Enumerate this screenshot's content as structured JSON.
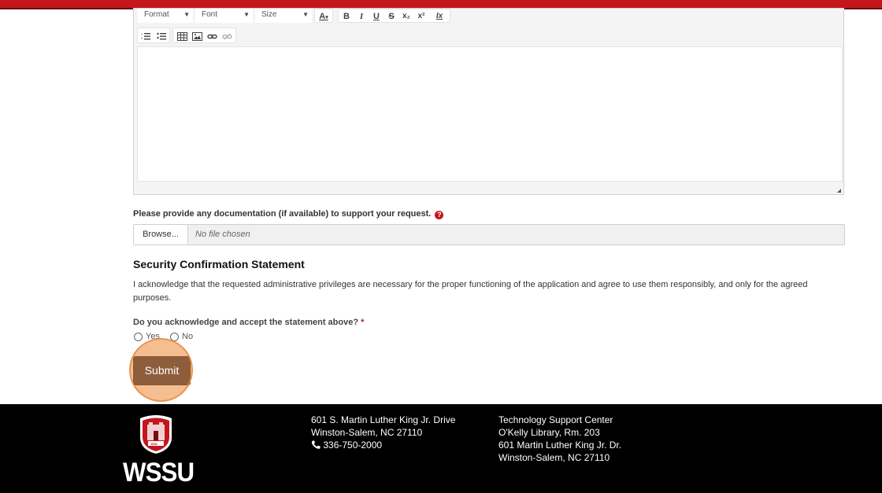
{
  "colors": {
    "brand_red": "#c4161c",
    "submit_bg": "#1b2b44",
    "highlight": "#ed8936"
  },
  "editor": {
    "format_label": "Format",
    "font_label": "Font",
    "size_label": "Size",
    "buttons_row1": [
      "A",
      "B",
      "I",
      "U",
      "S",
      "x₂",
      "x²",
      "Ix"
    ],
    "icons_row2": [
      "numbered-list-icon",
      "bulleted-list-icon",
      "table-icon",
      "image-icon",
      "link-icon",
      "unlink-icon"
    ]
  },
  "upload": {
    "label": "Please provide any documentation (if available) to support your request.",
    "help": "?",
    "browse": "Browse...",
    "no_file": "No file chosen"
  },
  "security": {
    "heading": "Security Confirmation Statement",
    "statement": "I acknowledge that the requested administrative privileges are necessary for the proper functioning of the application and agree to use them responsibly, and only for the agreed purposes.",
    "question": "Do you acknowledge and accept the statement above?",
    "required_mark": "*",
    "options": [
      "Yes",
      "No"
    ]
  },
  "submit_label": "Submit",
  "footer": {
    "logo_text": "WSSU",
    "seal_year": "1892",
    "address": [
      "601 S. Martin Luther King Jr. Drive",
      "Winston-Salem, NC 27110",
      "336-750-2000"
    ],
    "support": [
      "Technology Support Center",
      "O'Kelly Library, Rm. 203",
      "601 Martin Luther King Jr. Dr.",
      "Winston-Salem, NC 27110"
    ]
  }
}
